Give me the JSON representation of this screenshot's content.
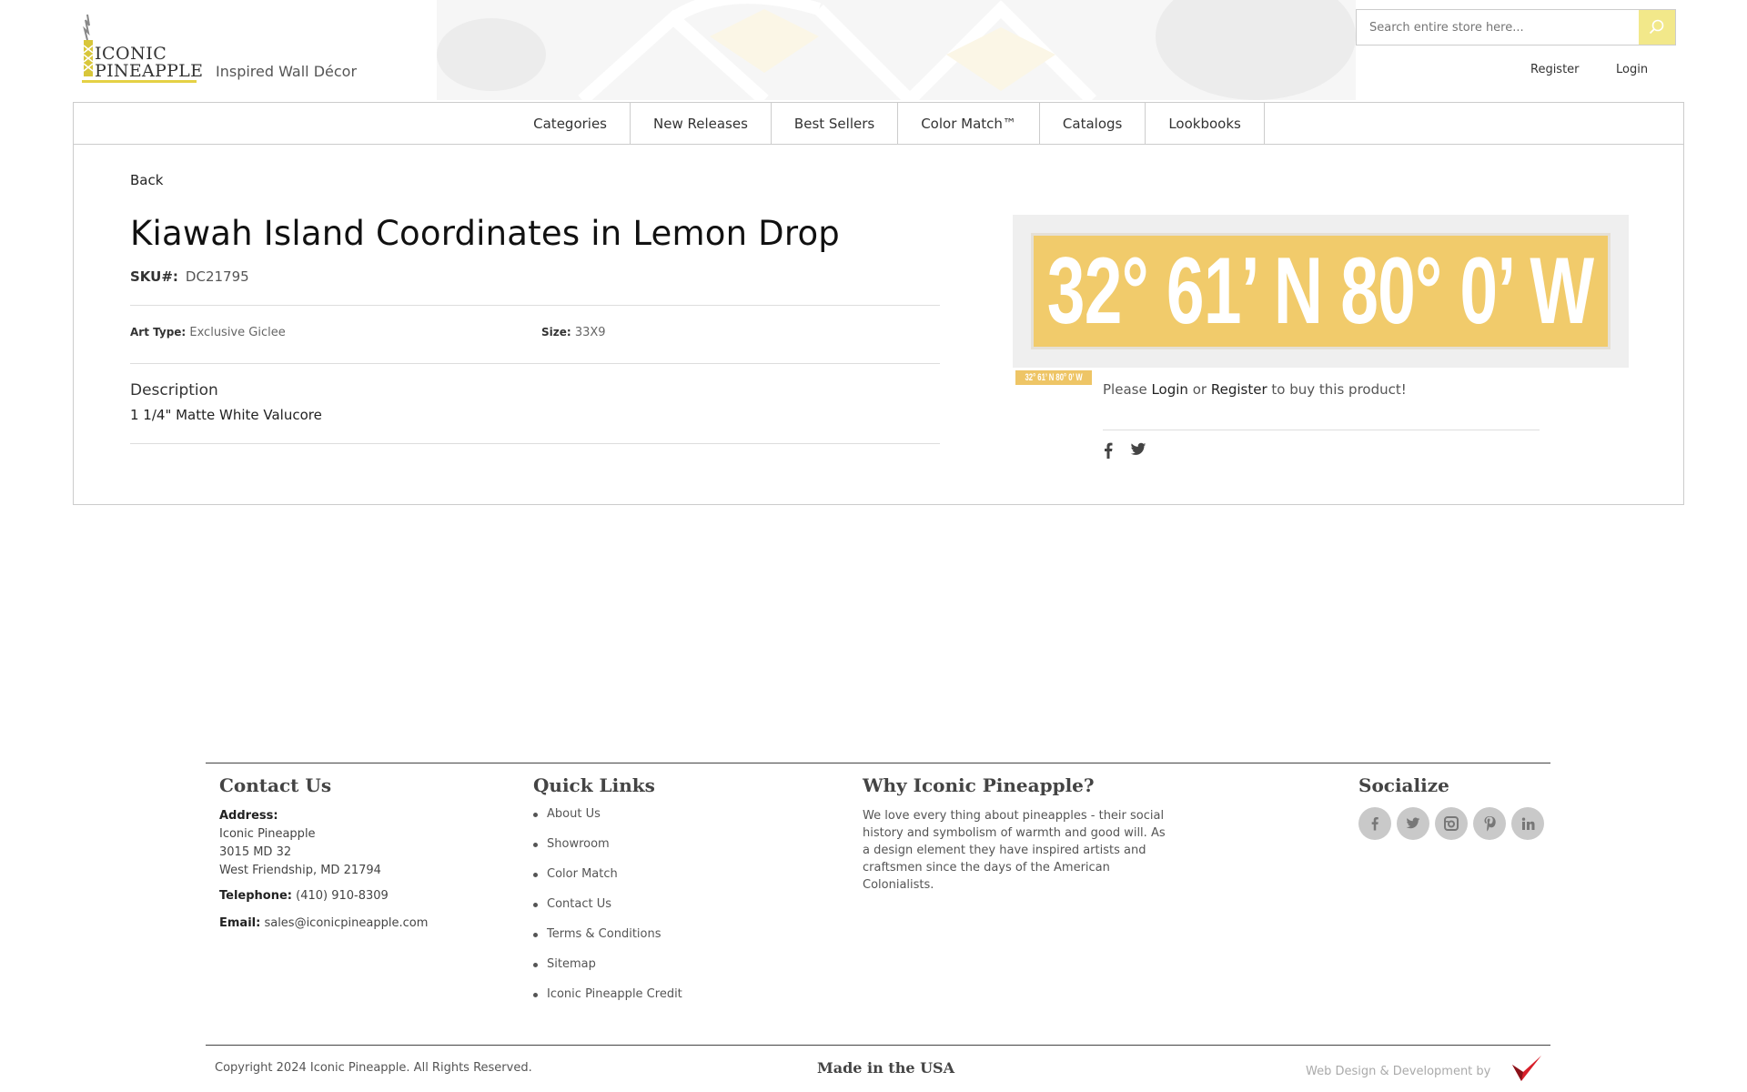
{
  "header": {
    "logo_line1": "ICONIC",
    "logo_line2": "PINEAPPLE",
    "tagline": "Inspired Wall Décor",
    "search_placeholder": "Search entire store here...",
    "register": "Register",
    "login": "Login",
    "accent_color": "#e5d145"
  },
  "nav": {
    "items": [
      "Categories",
      "New Releases",
      "Best Sellers",
      "Color Match™",
      "Catalogs",
      "Lookbooks"
    ]
  },
  "product": {
    "back": "Back",
    "title": "Kiawah Island Coordinates in Lemon Drop",
    "sku_label": "SKU#:",
    "sku": "DC21795",
    "art_type_label": "Art Type:",
    "art_type": "Exclusive Giclee",
    "size_label": "Size:",
    "size": "33X9",
    "description_heading": "Description",
    "description": "1 1/4\" Matte White Valucore",
    "artwork_text": "32° 61’ N 80° 0’ W",
    "thumb_text": "32° 61’ N 80° 0’ W",
    "artwork_color": "#f1cb6b",
    "buy_prefix": "Please",
    "buy_login": "Login",
    "buy_or": "or",
    "buy_register": "Register",
    "buy_suffix": "to buy this product!",
    "share_icons": [
      "facebook-icon",
      "twitter-icon"
    ]
  },
  "footer": {
    "contact_heading": "Contact Us",
    "address_label": "Address:",
    "address_line1": "Iconic Pineapple",
    "address_line2": "3015 MD 32",
    "address_line3": "West Friendship, MD 21794",
    "telephone_label": "Telephone:",
    "telephone": "(410) 910-8309",
    "email_label": "Email:",
    "email": "sales@iconicpineapple.com",
    "quick_links_heading": "Quick Links",
    "quick_links": [
      "About Us",
      "Showroom",
      "Color Match",
      "Contact Us",
      "Terms & Conditions",
      "Sitemap",
      "Iconic Pineapple Credit"
    ],
    "why_heading": "Why Iconic Pineapple?",
    "why_text": "We love every thing about pineapples - their social history and symbolism of warmth and good will. As a design element they have inspired artists and craftsmen since the days of the American Colonialists.",
    "socialize_heading": "Socialize",
    "social_icons": [
      "facebook-icon",
      "twitter-icon",
      "instagram-icon",
      "pinterest-icon",
      "linkedin-icon"
    ],
    "copyright": "Copyright 2024 Iconic Pineapple. All Rights Reserved.",
    "made_in": "Made in the USA",
    "credit": "Web Design & Development by"
  }
}
